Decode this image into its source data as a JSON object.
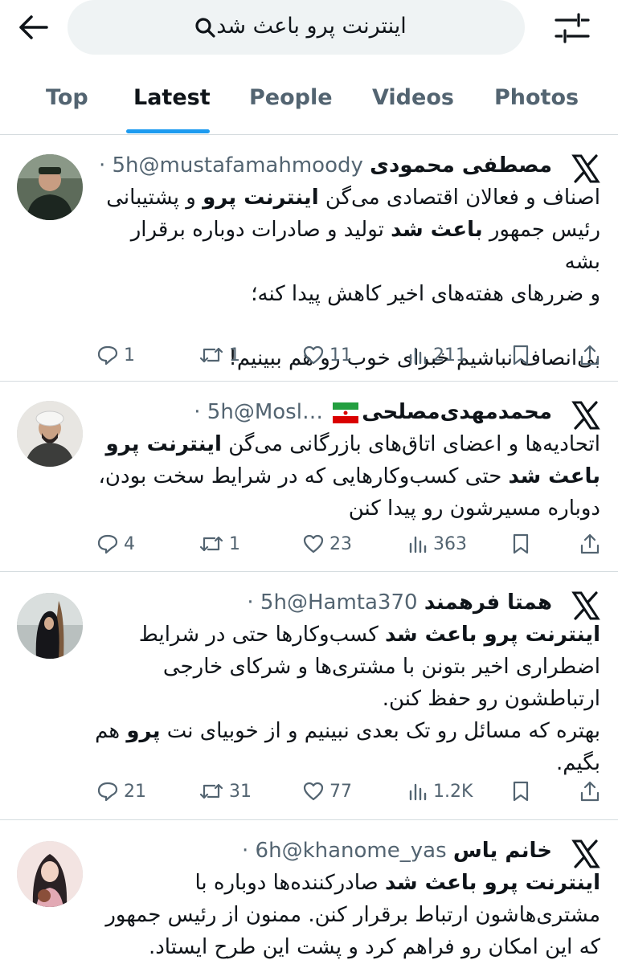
{
  "search": {
    "query": "اینترنت پرو باعث شد"
  },
  "tabs": [
    {
      "label": "Top"
    },
    {
      "label": "Latest"
    },
    {
      "label": "People"
    },
    {
      "label": "Videos"
    },
    {
      "label": "Photos"
    }
  ],
  "active_tab": "Latest",
  "colors": {
    "accent": "#1d9bf0",
    "muted": "#536471",
    "text": "#0f1419",
    "divider": "#d5dcdf",
    "search_bg": "#eff3f4"
  },
  "posts": [
    {
      "name": "مصطفی محمودی",
      "handle": "@mustafamahmoody",
      "time": "· 5h",
      "lines": [
        [
          "اصناف و فعالان اقتصادی می‌گن ",
          {
            "b": "اینترنت پرو"
          },
          " و پشتیبانی"
        ],
        [
          "رئیس جمهور ",
          {
            "b": "باعث شد"
          },
          " تولید و صادرات دوباره برقرار بشه"
        ],
        [
          "و ضررهای هفته‌های اخیر کاهش پیدا کنه؛"
        ],
        [
          ""
        ],
        [
          "بی‌انصاف نباشیم خبرای خوب رو هم ببینیم!"
        ]
      ],
      "stats": {
        "replies": "1",
        "reposts": "1",
        "likes": "11",
        "views": "211"
      }
    },
    {
      "name": "محمدمهدی‌مصلحی",
      "handle": "@Mosl…",
      "time": "· 5h",
      "flag_icon": "iran-flag-icon",
      "lines": [
        [
          "اتحادیه‌ها و اعضای اتاق‌های بازرگانی می‌گن ",
          {
            "b": "اینترنت پرو"
          }
        ],
        [
          {
            "b": "باعث شد"
          },
          " حتی کسب‌وکارهایی که در شرایط سخت بودن،"
        ],
        [
          "دوباره مسیرشون رو پیدا کنن"
        ]
      ],
      "stats": {
        "replies": "4",
        "reposts": "1",
        "likes": "23",
        "views": "363"
      }
    },
    {
      "name": "همتا فرهمند",
      "handle": "@Hamta370",
      "time": "· 5h",
      "lines": [
        [
          {
            "b": "اینترنت پرو باعث شد"
          },
          " کسب‌وکارها حتی در شرایط"
        ],
        [
          "اضطراری اخیر بتونن با مشتری‌ها و شرکای خارجی"
        ],
        [
          "ارتباطشون رو حفظ کنن."
        ],
        [
          "بهتره که مسائل رو تک بعدی نبینیم و از خوبیای نت ",
          {
            "b": "پرو"
          },
          " هم"
        ],
        [
          "بگیم."
        ]
      ],
      "stats": {
        "replies": "21",
        "reposts": "31",
        "likes": "77",
        "views": "1.2K"
      }
    },
    {
      "name": "خانم یاس",
      "handle": "@khanome_yas",
      "time": "· 6h",
      "lines": [
        [
          {
            "b": "اینترنت پرو باعث شد"
          },
          " صادرکننده‌ها دوباره با"
        ],
        [
          "مشتری‌هاشون ارتباط برقرار کنن. ممنون از رئیس جمهور"
        ],
        [
          "که این امکان رو فراهم کرد و پشت این طرح ایستاد."
        ]
      ]
    }
  ]
}
